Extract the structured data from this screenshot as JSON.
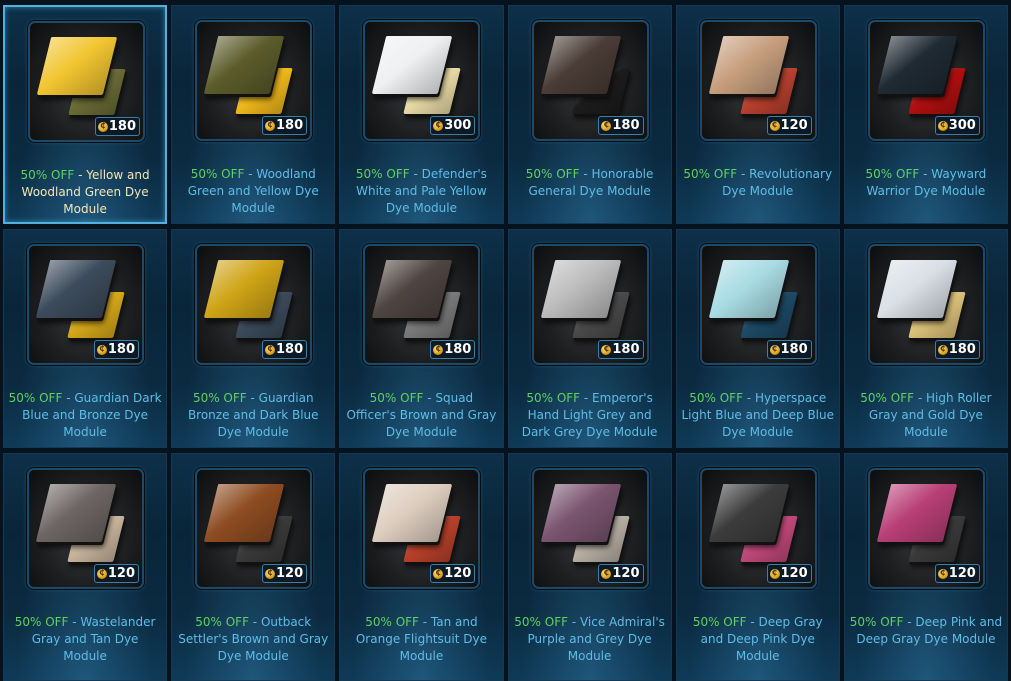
{
  "accent": "#5fbde6",
  "discount_color": "#5fd25f",
  "items": [
    {
      "discount": "50% OFF",
      "name": "Yellow and Woodland Green Dye Module",
      "price": "180",
      "selected": true,
      "front": "#f2c531",
      "back": "#6a6b35"
    },
    {
      "discount": "50% OFF",
      "name": "Woodland Green and Yellow Dye Module",
      "price": "180",
      "selected": false,
      "front": "#5b5c2b",
      "back": "#f0b81b"
    },
    {
      "discount": "50% OFF",
      "name": "Defender's White and Pale Yellow Dye Module",
      "price": "300",
      "selected": false,
      "front": "#eef0f2",
      "back": "#e9dba6"
    },
    {
      "discount": "50% OFF",
      "name": "Honorable General Dye Module",
      "price": "180",
      "selected": false,
      "front": "#4a3c36",
      "back": "#1c1c1c"
    },
    {
      "discount": "50% OFF",
      "name": "Revolutionary Dye Module",
      "price": "120",
      "selected": false,
      "front": "#c79f7e",
      "back": "#b8402f"
    },
    {
      "discount": "50% OFF",
      "name": "Wayward Warrior Dye Module",
      "price": "300",
      "selected": false,
      "front": "#1f2a33",
      "back": "#b10f0f"
    },
    {
      "discount": "50% OFF",
      "name": "Guardian Dark Blue and Bronze Dye Module",
      "price": "180",
      "selected": false,
      "front": "#3c4b5b",
      "back": "#d6a81a"
    },
    {
      "discount": "50% OFF",
      "name": "Guardian Bronze and Dark Blue Dye Module",
      "price": "180",
      "selected": false,
      "front": "#cfa417",
      "back": "#3b4a5a"
    },
    {
      "discount": "50% OFF",
      "name": "Squad Officer's Brown and Gray Dye Module",
      "price": "180",
      "selected": false,
      "front": "#4e4440",
      "back": "#7a7a7a"
    },
    {
      "discount": "50% OFF",
      "name": "Emperor's Hand Light Grey and Dark Grey Dye Module",
      "price": "180",
      "selected": false,
      "front": "#bcbcbc",
      "back": "#4a4a4a"
    },
    {
      "discount": "50% OFF",
      "name": "Hyperspace Light Blue and Deep Blue Dye Module",
      "price": "180",
      "selected": false,
      "front": "#a8dbe3",
      "back": "#1c4a66"
    },
    {
      "discount": "50% OFF",
      "name": "High Roller Gray and Gold Dye Module",
      "price": "180",
      "selected": false,
      "front": "#d9e0e6",
      "back": "#dcc27a"
    },
    {
      "discount": "50% OFF",
      "name": "Wastelander Gray and Tan Dye Module",
      "price": "120",
      "selected": false,
      "front": "#6d6563",
      "back": "#c7b49c"
    },
    {
      "discount": "50% OFF",
      "name": "Outback Settler's Brown and Gray Dye Module",
      "price": "120",
      "selected": false,
      "front": "#8e4c22",
      "back": "#3a3a3a"
    },
    {
      "discount": "50% OFF",
      "name": "Tan and Orange Flightsuit Dye Module",
      "price": "120",
      "selected": false,
      "front": "#ddcdbf",
      "back": "#b8412a"
    },
    {
      "discount": "50% OFF",
      "name": "Vice Admiral's Purple and Grey Dye Module",
      "price": "120",
      "selected": false,
      "front": "#7a5570",
      "back": "#b8afa4"
    },
    {
      "discount": "50% OFF",
      "name": "Deep Gray and Deep Pink Dye Module",
      "price": "120",
      "selected": false,
      "front": "#3c3c3c",
      "back": "#c0487a"
    },
    {
      "discount": "50% OFF",
      "name": "Deep Pink and Deep Gray Dye Module",
      "price": "120",
      "selected": false,
      "front": "#b83f76",
      "back": "#3a3a3a"
    }
  ]
}
